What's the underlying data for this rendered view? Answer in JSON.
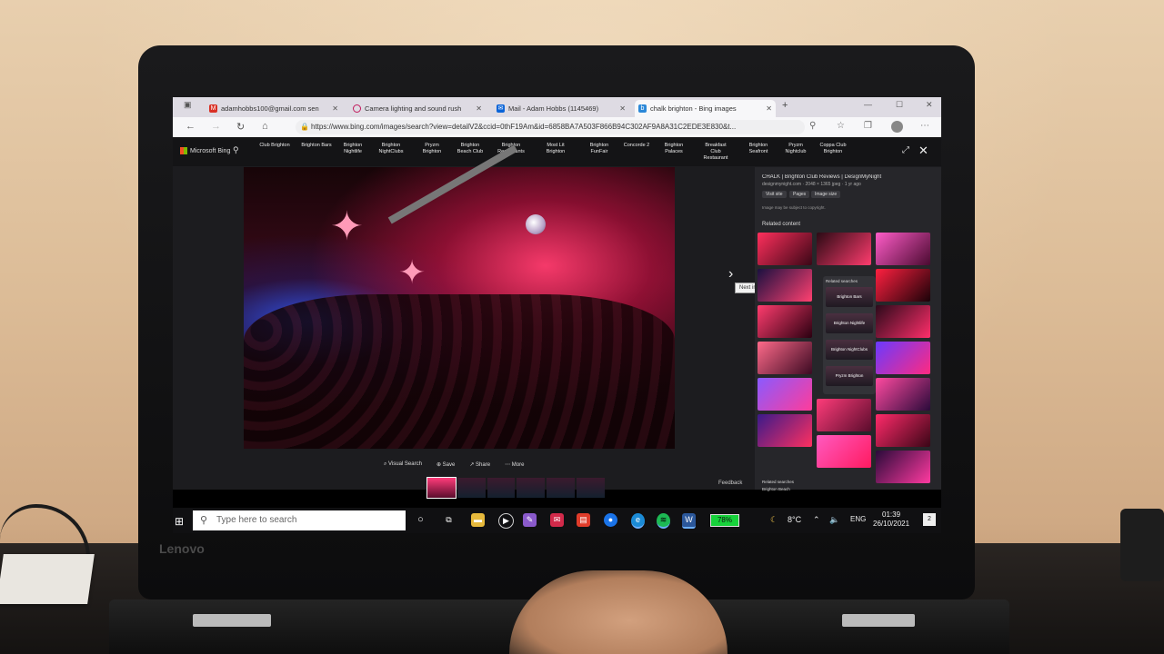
{
  "browser": {
    "tabs": [
      {
        "label": "adamhobbs100@gmail.com sen",
        "icon": "gmail-icon"
      },
      {
        "label": "Camera lighting and sound rush",
        "icon": "loading-icon"
      },
      {
        "label": "Mail - Adam Hobbs (1145469)",
        "icon": "mail-icon"
      },
      {
        "label": "chalk brighton - Bing images",
        "icon": "bing-icon"
      }
    ],
    "new_tab": "+",
    "url": "https://www.bing.com/images/search?view=detailV2&ccid=0thF19Am&id=6858BA7A503F866B94C302AF9A8A31C2EDE3E830&t..."
  },
  "bing": {
    "logo": "Microsoft Bing",
    "pills": [
      "Club Brighton",
      "Brighton Bars",
      "Brighton Nightlife",
      "Brighton NightClubs",
      "Pryzm Brighton",
      "Brighton Beach Club",
      "Brighton Restaurants",
      "Most Lit Brighton",
      "Brighton FunFair",
      "Concorde 2",
      "Brighton Palaces",
      "Breakfast Club Restaurant",
      "Brighton Seafront",
      "Pryzm Nightclub",
      "Coppa Club Brighton"
    ],
    "tooltip": "Next image result",
    "actions": [
      "Visual Search",
      "Save",
      "Share",
      "More"
    ],
    "feedback": "Feedback",
    "side": {
      "title": "CHALK | Brighton Club Reviews | DesignMyNight",
      "sub": "designmynight.com · 2048 × 1365 jpeg · 1 yr ago",
      "buttons": [
        "Visit site",
        "Pages",
        "Image size"
      ],
      "copyright": "Image may be subject to copyright.",
      "related_content": "Related content",
      "related_searches": "Related searches",
      "related_items": [
        "Brighton Bars",
        "Brighton Nightlife",
        "Brighton NightClubs",
        "Pryzm Brighton"
      ],
      "related_searches_2": "Related searches",
      "related_item_2": "Brighton Beach"
    }
  },
  "taskbar": {
    "search_placeholder": "Type here to search",
    "battery": "78%",
    "weather": "8°C",
    "language": "ENG",
    "time": "01:39",
    "date": "26/10/2021",
    "notifications": "2"
  },
  "bezel": {
    "brand": "Lenovo"
  },
  "colors": {
    "accent_pink": "#ff3c7a",
    "battery_green": "#17d23b",
    "taskbar": "#101012"
  }
}
